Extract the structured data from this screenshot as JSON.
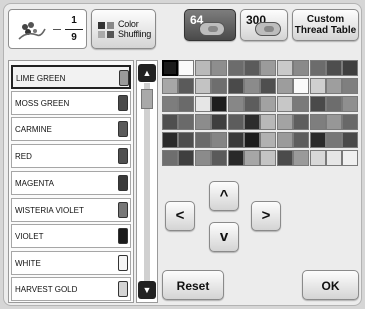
{
  "header": {
    "preview": {
      "current": "1",
      "total": "9"
    },
    "shuffle_label": "Color Shuffling",
    "modes": [
      {
        "label": "64",
        "selected": true
      },
      {
        "label": "300",
        "selected": false
      },
      {
        "label": "Custom Thread Table",
        "selected": false
      }
    ]
  },
  "thread_list": {
    "items": [
      {
        "name": "LIME GREEN",
        "selected": true,
        "spool_color": "#9a9a9a"
      },
      {
        "name": "MOSS GREEN",
        "selected": false,
        "spool_color": "#4a4a4a"
      },
      {
        "name": "CARMINE",
        "selected": false,
        "spool_color": "#5a5a5a"
      },
      {
        "name": "RED",
        "selected": false,
        "spool_color": "#505050"
      },
      {
        "name": "MAGENTA",
        "selected": false,
        "spool_color": "#3a3a3a"
      },
      {
        "name": "WISTERIA VIOLET",
        "selected": false,
        "spool_color": "#777777"
      },
      {
        "name": "VIOLET",
        "selected": false,
        "spool_color": "#1a1a1a"
      },
      {
        "name": "WHITE",
        "selected": false,
        "spool_color": "#f6f6f6"
      },
      {
        "name": "HARVEST GOLD",
        "selected": false,
        "spool_color": "#d4d4d4"
      }
    ]
  },
  "scroll": {
    "up_icon": "triangle-up-icon",
    "down_icon": "triangle-down-icon"
  },
  "palette": {
    "rows": [
      [
        "#1a1a1a",
        "#fafafa",
        "#b9b9b9",
        "#8e8e8e",
        "#6c6c6c",
        "#5b5b5b",
        "#9b9b9b",
        "#c9c9c9",
        "#8a8a8a",
        "#6c6c6c",
        "#4e4e4e",
        "#3f3f3f"
      ],
      [
        "#a7a7a7",
        "#5a5a5a",
        "#c3c3c3",
        "#6e6e6e",
        "#4a4a4a",
        "#8b8b8b",
        "#4f4f4f",
        "#9d9d9d",
        "#fafafa",
        "#cfcfcf",
        "#9e9e9e",
        "#7f7f7f"
      ],
      [
        "#7d7d7d",
        "#6a6a6a",
        "#e6e6e6",
        "#1d1d1d",
        "#878787",
        "#5d5d5d",
        "#a2a2a2",
        "#c7c7c7",
        "#7a7a7a",
        "#4a4a4a",
        "#6d6d6d",
        "#8f8f8f"
      ],
      [
        "#4f4f4f",
        "#6a6a6a",
        "#8c8c8c",
        "#3e3e3e",
        "#5d5d5d",
        "#2c2c2c",
        "#b8b8b8",
        "#a3a3a3",
        "#5e5e5e",
        "#7e7e7e",
        "#979797",
        "#686868"
      ],
      [
        "#2a2a2a",
        "#4d4d4d",
        "#6a6a6a",
        "#858585",
        "#3a3a3a",
        "#1c1c1c",
        "#b1b1b1",
        "#9a9a9a",
        "#5d5d5d",
        "#2a2a2a",
        "#767676",
        "#4a4a4a"
      ],
      [
        "#6e6e6e",
        "#3f3f3f",
        "#8b8b8b",
        "#5a5a5a",
        "#292929",
        "#a6a6a6",
        "#c4c4c4",
        "#4b4b4b",
        "#9a9a9a",
        "#d8d8d8",
        "#e6e6e6",
        "#f0f0f0"
      ]
    ],
    "selected": {
      "row": 0,
      "col": 0
    }
  },
  "nav": {
    "up": "^",
    "left": "<",
    "right": ">",
    "down": "v"
  },
  "buttons": {
    "reset": "Reset",
    "ok": "OK"
  }
}
